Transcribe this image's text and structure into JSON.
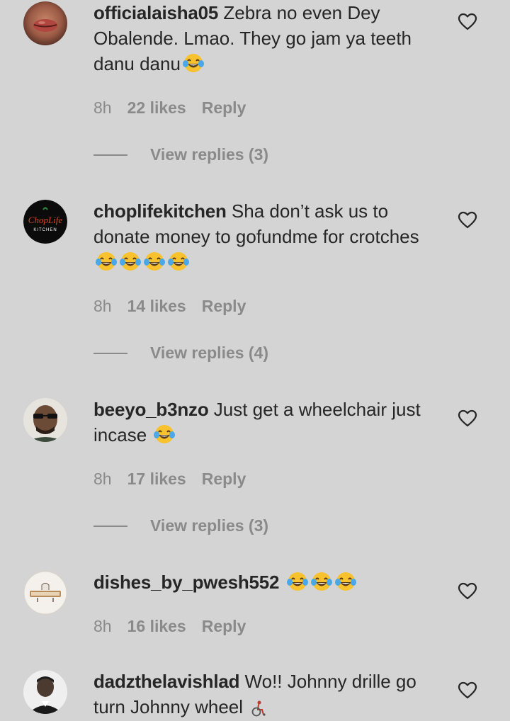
{
  "comments": [
    {
      "avatar": "lips-portrait-avatar",
      "username": "officialaisha05",
      "text": " Zebra no even Dey Obalende. Lmao. They go jam ya teeth danu danu",
      "emoji": [
        "laughing-tears-emoji"
      ],
      "time": "8h",
      "likes": "22 likes",
      "reply": "Reply",
      "view_replies": "View replies (3)"
    },
    {
      "avatar": "choplife-kitchen-logo",
      "avatar_logo_text": "ChopLife",
      "avatar_logo_sub": "KITCHEN",
      "username": "choplifekitchen",
      "text": " Sha don’t ask us to donate money to gofundme for crotches ",
      "emoji": [
        "laughing-tears-emoji",
        "laughing-tears-emoji",
        "laughing-tears-emoji",
        "laughing-tears-emoji"
      ],
      "time": "8h",
      "likes": "14 likes",
      "reply": "Reply",
      "view_replies": "View replies (4)"
    },
    {
      "avatar": "sunglasses-man-avatar",
      "username": "beeyo_b3nzo",
      "text": " Just get a wheelchair just incase ",
      "emoji": [
        "laughing-tears-emoji"
      ],
      "time": "8h",
      "likes": "17 likes",
      "reply": "Reply",
      "view_replies": "View replies (3)"
    },
    {
      "avatar": "dishes-logo-avatar",
      "username": "dishes_by_pwesh552",
      "text": " ",
      "emoji": [
        "laughing-tears-emoji",
        "laughing-tears-emoji",
        "laughing-tears-emoji"
      ],
      "time": "8h",
      "likes": "16 likes",
      "reply": "Reply"
    },
    {
      "avatar": "man-portrait-avatar",
      "username": "dadzthelavishlad",
      "text": " Wo!! Johnny drille go turn Johnny wheel ",
      "emoji": [
        "wheelchair-emoji"
      ]
    }
  ],
  "icons": {
    "heart": "heart-outline-icon"
  },
  "colors": {
    "background": "#d4d4d4",
    "text": "#262626",
    "muted": "#8a8a8a"
  }
}
